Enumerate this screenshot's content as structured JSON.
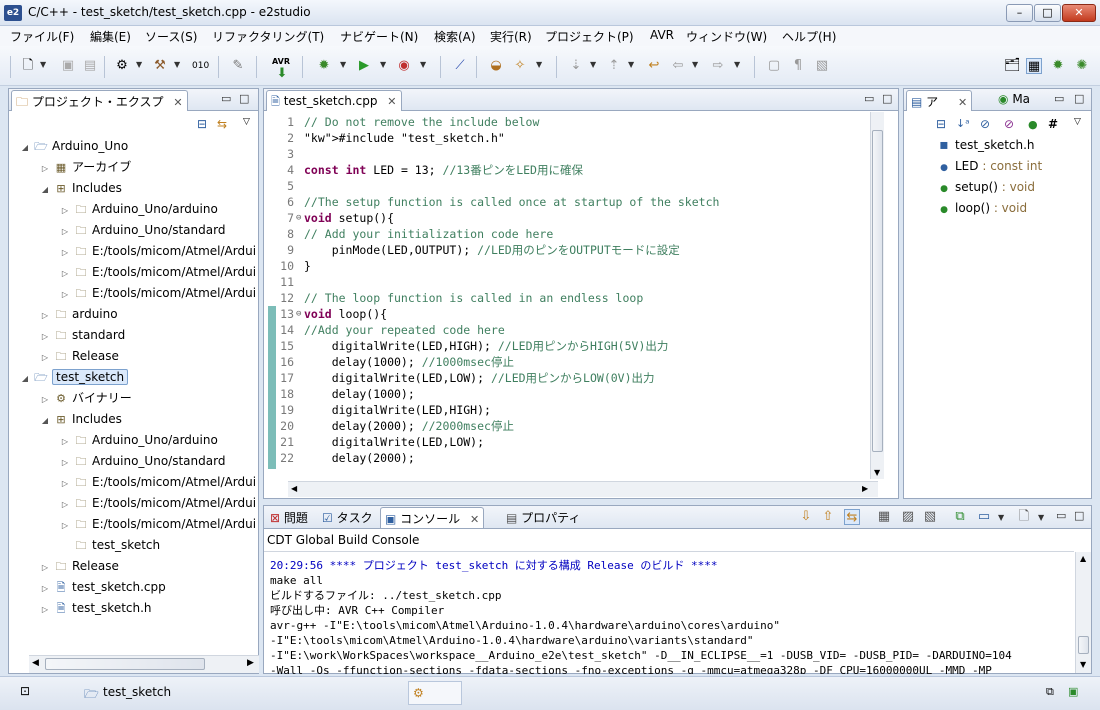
{
  "window": {
    "title": "C/C++ - test_sketch/test_sketch.cpp - e2studio",
    "app_icon": "e2"
  },
  "menu": [
    "ファイル(F)",
    "編集(E)",
    "ソース(S)",
    "リファクタリング(T)",
    "ナビゲート(N)",
    "検索(A)",
    "実行(R)",
    "プロジェクト(P)",
    "AVR",
    "ウィンドウ(W)",
    "ヘルプ(H)"
  ],
  "toolbar": {
    "avr_label": "AVR"
  },
  "project_explorer": {
    "tab_label": "プロジェクト・エクスプ",
    "rows": [
      {
        "label": "Arduino_Uno",
        "icon": "project-icon"
      },
      {
        "label": "アーカイブ",
        "icon": "archive-icon"
      },
      {
        "label": "Includes",
        "icon": "includes-icon"
      },
      {
        "label": "Arduino_Uno/arduino",
        "icon": "folder-icon"
      },
      {
        "label": "Arduino_Uno/standard",
        "icon": "folder-icon"
      },
      {
        "label": "E:/tools/micom/Atmel/Ardui",
        "icon": "folder-icon"
      },
      {
        "label": "E:/tools/micom/Atmel/Ardui",
        "icon": "folder-icon"
      },
      {
        "label": "E:/tools/micom/Atmel/Ardui",
        "icon": "folder-icon"
      },
      {
        "label": "arduino",
        "icon": "source-folder-icon"
      },
      {
        "label": "standard",
        "icon": "source-folder-icon"
      },
      {
        "label": "Release",
        "icon": "folder-icon"
      },
      {
        "label": "test_sketch",
        "icon": "project-icon"
      },
      {
        "label": "バイナリー",
        "icon": "binary-icon"
      },
      {
        "label": "Includes",
        "icon": "includes-icon"
      },
      {
        "label": "Arduino_Uno/arduino",
        "icon": "folder-icon"
      },
      {
        "label": "Arduino_Uno/standard",
        "icon": "folder-icon"
      },
      {
        "label": "E:/tools/micom/Atmel/Ardui",
        "icon": "folder-icon"
      },
      {
        "label": "E:/tools/micom/Atmel/Ardui",
        "icon": "folder-icon"
      },
      {
        "label": "E:/tools/micom/Atmel/Ardui",
        "icon": "folder-icon"
      },
      {
        "label": "test_sketch",
        "icon": "folder-icon"
      },
      {
        "label": "Release",
        "icon": "folder-icon"
      },
      {
        "label": "test_sketch.cpp",
        "icon": "cpp-file-icon"
      },
      {
        "label": "test_sketch.h",
        "icon": "header-file-icon"
      }
    ]
  },
  "editor": {
    "tab_label": "test_sketch.cpp",
    "line_numbers": [
      "1",
      "2",
      "3",
      "4",
      "5",
      "6",
      "7",
      "8",
      "9",
      "10",
      "11",
      "12",
      "13",
      "14",
      "15",
      "16",
      "17",
      "18",
      "19",
      "20",
      "21",
      "22",
      "23"
    ],
    "lines": [
      "// Do not remove the include below",
      "#include \"test_sketch.h\"",
      "",
      "const int LED = 13; //13番ピンをLED用に確保",
      "",
      "//The setup function is called once at startup of the sketch",
      "void setup(){",
      "// Add your initialization code here",
      "    pinMode(LED,OUTPUT); //LED用のピンをOUTPUTモードに設定",
      "}",
      "",
      "// The loop function is called in an endless loop",
      "void loop(){",
      "//Add your repeated code here",
      "    digitalWrite(LED,HIGH); //LED用ピンからHIGH(5V)出力",
      "    delay(1000); //1000msec停止",
      "    digitalWrite(LED,LOW); //LED用ピンからLOW(0V)出力",
      "    delay(1000);",
      "    digitalWrite(LED,HIGH);",
      "    delay(2000); //2000msec停止",
      "    digitalWrite(LED,LOW);",
      "    delay(2000);",
      "}"
    ]
  },
  "outline": {
    "tab1_label": "ア",
    "tab2_label": "Ma",
    "items": [
      {
        "label": "test_sketch.h",
        "type": ""
      },
      {
        "label": "LED",
        "type": " : const int"
      },
      {
        "label": "setup()",
        "type": " : void"
      },
      {
        "label": "loop()",
        "type": " : void"
      }
    ]
  },
  "bottom_panel": {
    "tabs": [
      "問題",
      "タスク",
      "コンソール",
      "プロパティ"
    ],
    "console_title": "CDT Global Build Console",
    "lines": [
      "20:29:56 **** プロジェクト test_sketch に対する構成 Release のビルド ****",
      "make all",
      "ビルドするファイル: ../test_sketch.cpp",
      "呼び出し中: AVR C++ Compiler",
      "avr-g++ -I\"E:\\tools\\micom\\Atmel\\Arduino-1.0.4\\hardware\\arduino\\cores\\arduino\"",
      "-I\"E:\\tools\\micom\\Atmel\\Arduino-1.0.4\\hardware\\arduino\\variants\\standard\"",
      "-I\"E:\\work\\WorkSpaces\\workspace__Arduino_e2e\\test_sketch\" -D__IN_ECLIPSE__=1 -DUSB_VID= -DUSB_PID= -DARDUINO=104",
      "-Wall -Os -ffunction-sections -fdata-sections -fno-exceptions -g -mmcu=atmega328p -DF_CPU=16000000UL -MMD -MP"
    ]
  },
  "statusbar": {
    "selected_item": "test_sketch"
  },
  "colors": {
    "comment": "#3f7f5f",
    "keyword": "#7f0055",
    "string": "#2a00ff",
    "console_header": "#0000c0"
  }
}
